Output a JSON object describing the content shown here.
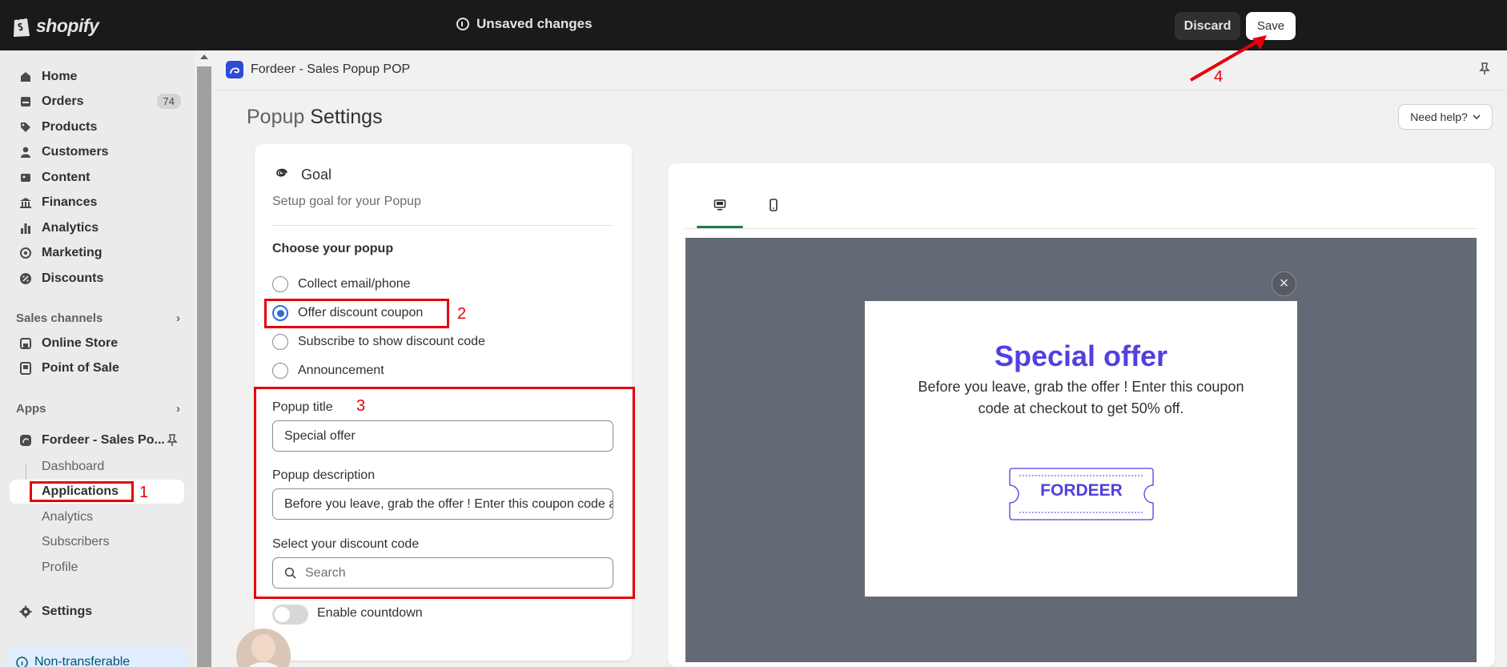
{
  "topbar": {
    "logo_text": "shopify",
    "status": "Unsaved changes",
    "discard_label": "Discard",
    "save_label": "Save"
  },
  "sidebar": {
    "items": [
      {
        "label": "Home",
        "icon": "home-icon"
      },
      {
        "label": "Orders",
        "icon": "orders-icon",
        "badge": "74"
      },
      {
        "label": "Products",
        "icon": "tag-icon"
      },
      {
        "label": "Customers",
        "icon": "person-icon"
      },
      {
        "label": "Content",
        "icon": "content-icon"
      },
      {
        "label": "Finances",
        "icon": "bank-icon"
      },
      {
        "label": "Analytics",
        "icon": "bar-chart-icon"
      },
      {
        "label": "Marketing",
        "icon": "target-icon"
      },
      {
        "label": "Discounts",
        "icon": "discount-icon"
      }
    ],
    "sales_channels_heading": "Sales channels",
    "channels": [
      {
        "label": "Online Store",
        "icon": "store-icon"
      },
      {
        "label": "Point of Sale",
        "icon": "pos-icon"
      }
    ],
    "apps_heading": "Apps",
    "app_name": "Fordeer - Sales Po...",
    "app_subitems": [
      "Dashboard",
      "Applications",
      "Analytics",
      "Subscribers",
      "Profile"
    ],
    "settings_label": "Settings",
    "non_transferable": "Non-transferable"
  },
  "appbar": {
    "title": "Fordeer - Sales Popup POP"
  },
  "breadcrumb": {
    "parent": "Popup",
    "current": "Settings"
  },
  "need_help_label": "Need help?",
  "goal": {
    "title": "Goal",
    "description": "Setup goal for your Popup",
    "choose_heading": "Choose your popup",
    "options": [
      "Collect email/phone",
      "Offer discount coupon",
      "Subscribe to show discount code",
      "Announcement"
    ],
    "selected_index": 1
  },
  "form": {
    "title_label": "Popup title",
    "title_value": "Special offer",
    "description_label": "Popup description",
    "description_value": "Before you leave, grab the offer ! Enter this coupon code at checkout to get 50% off.",
    "discount_label": "Select your discount code",
    "discount_placeholder": "Search",
    "countdown_label": "Enable countdown",
    "countdown_enabled": false
  },
  "preview": {
    "tabs": [
      "desktop-icon",
      "mobile-icon"
    ],
    "active_tab": "desktop-icon",
    "popup_title": "Special offer",
    "popup_description": "Before you leave, grab the offer ! Enter this coupon code at checkout to get 50% off.",
    "coupon_code": "FORDEER"
  },
  "annotations": {
    "numbers": [
      "1",
      "2",
      "3",
      "4"
    ],
    "color": "#e5000b"
  },
  "colors": {
    "topbar": "#1a1a1a",
    "accent_purple": "#5140e0",
    "radio_blue": "#2a6fd6",
    "tab_green": "#1b7a5a",
    "preview_bg": "#636a76"
  }
}
